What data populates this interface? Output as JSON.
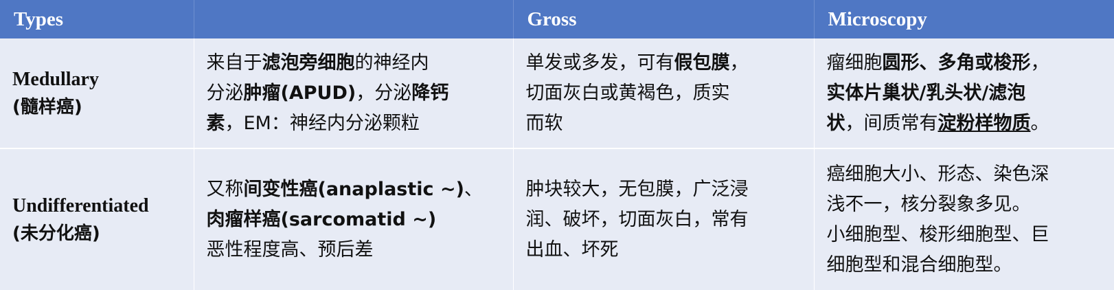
{
  "header": {
    "col_types": "Types",
    "col_description": "",
    "col_gross": "Gross",
    "col_microscopy": "Microscopy"
  },
  "rows": [
    {
      "type_en": "Medullary",
      "type_cn": "(髓样癌)",
      "description": {
        "l1_a": "来自于",
        "l1_b": "滤泡旁细胞",
        "l1_c": "的神经内",
        "l2_a": "分泌",
        "l2_b": "肿瘤(APUD)",
        "l2_c": "，分泌",
        "l2_d": "降钙",
        "l3_a": "素",
        "l3_b": "，EM：神经内分泌颗粒"
      },
      "gross": {
        "l1_a": "单发或多发，可有",
        "l1_b": "假包膜",
        "l1_c": "，",
        "l2": "切面灰白或黄褐色，质实",
        "l3": "而软"
      },
      "microscopy": {
        "l1_a": "瘤细胞",
        "l1_b": "圆形、多角或梭形",
        "l1_c": "，",
        "l2": "实体片巢状/乳头状/滤泡",
        "l3_a": "状",
        "l3_b": "，间质常有",
        "l3_c": "淀粉样物质",
        "l3_d": "。"
      }
    },
    {
      "type_en": "Undifferentiated",
      "type_cn": "(未分化癌)",
      "description": {
        "l1_a": "又称",
        "l1_b": "间变性癌(anaplastic ~)",
        "l1_c": "、",
        "l2": "肉瘤样癌(sarcomatid ~)",
        "l3": "恶性程度高、预后差"
      },
      "gross": {
        "l1": "肿块较大，无包膜，广泛浸",
        "l2": "润、破坏，切面灰白，常有",
        "l3": "出血、坏死"
      },
      "microscopy": {
        "l1": "癌细胞大小、形态、染色深",
        "l2": "浅不一，核分裂象多见。",
        "l3": "小细胞型、梭形细胞型、巨",
        "l4": "细胞型和混合细胞型。"
      }
    }
  ],
  "colors": {
    "header_bg": "#4f77c4",
    "row_bg": "#e7ebf5",
    "header_text": "#ffffff"
  }
}
